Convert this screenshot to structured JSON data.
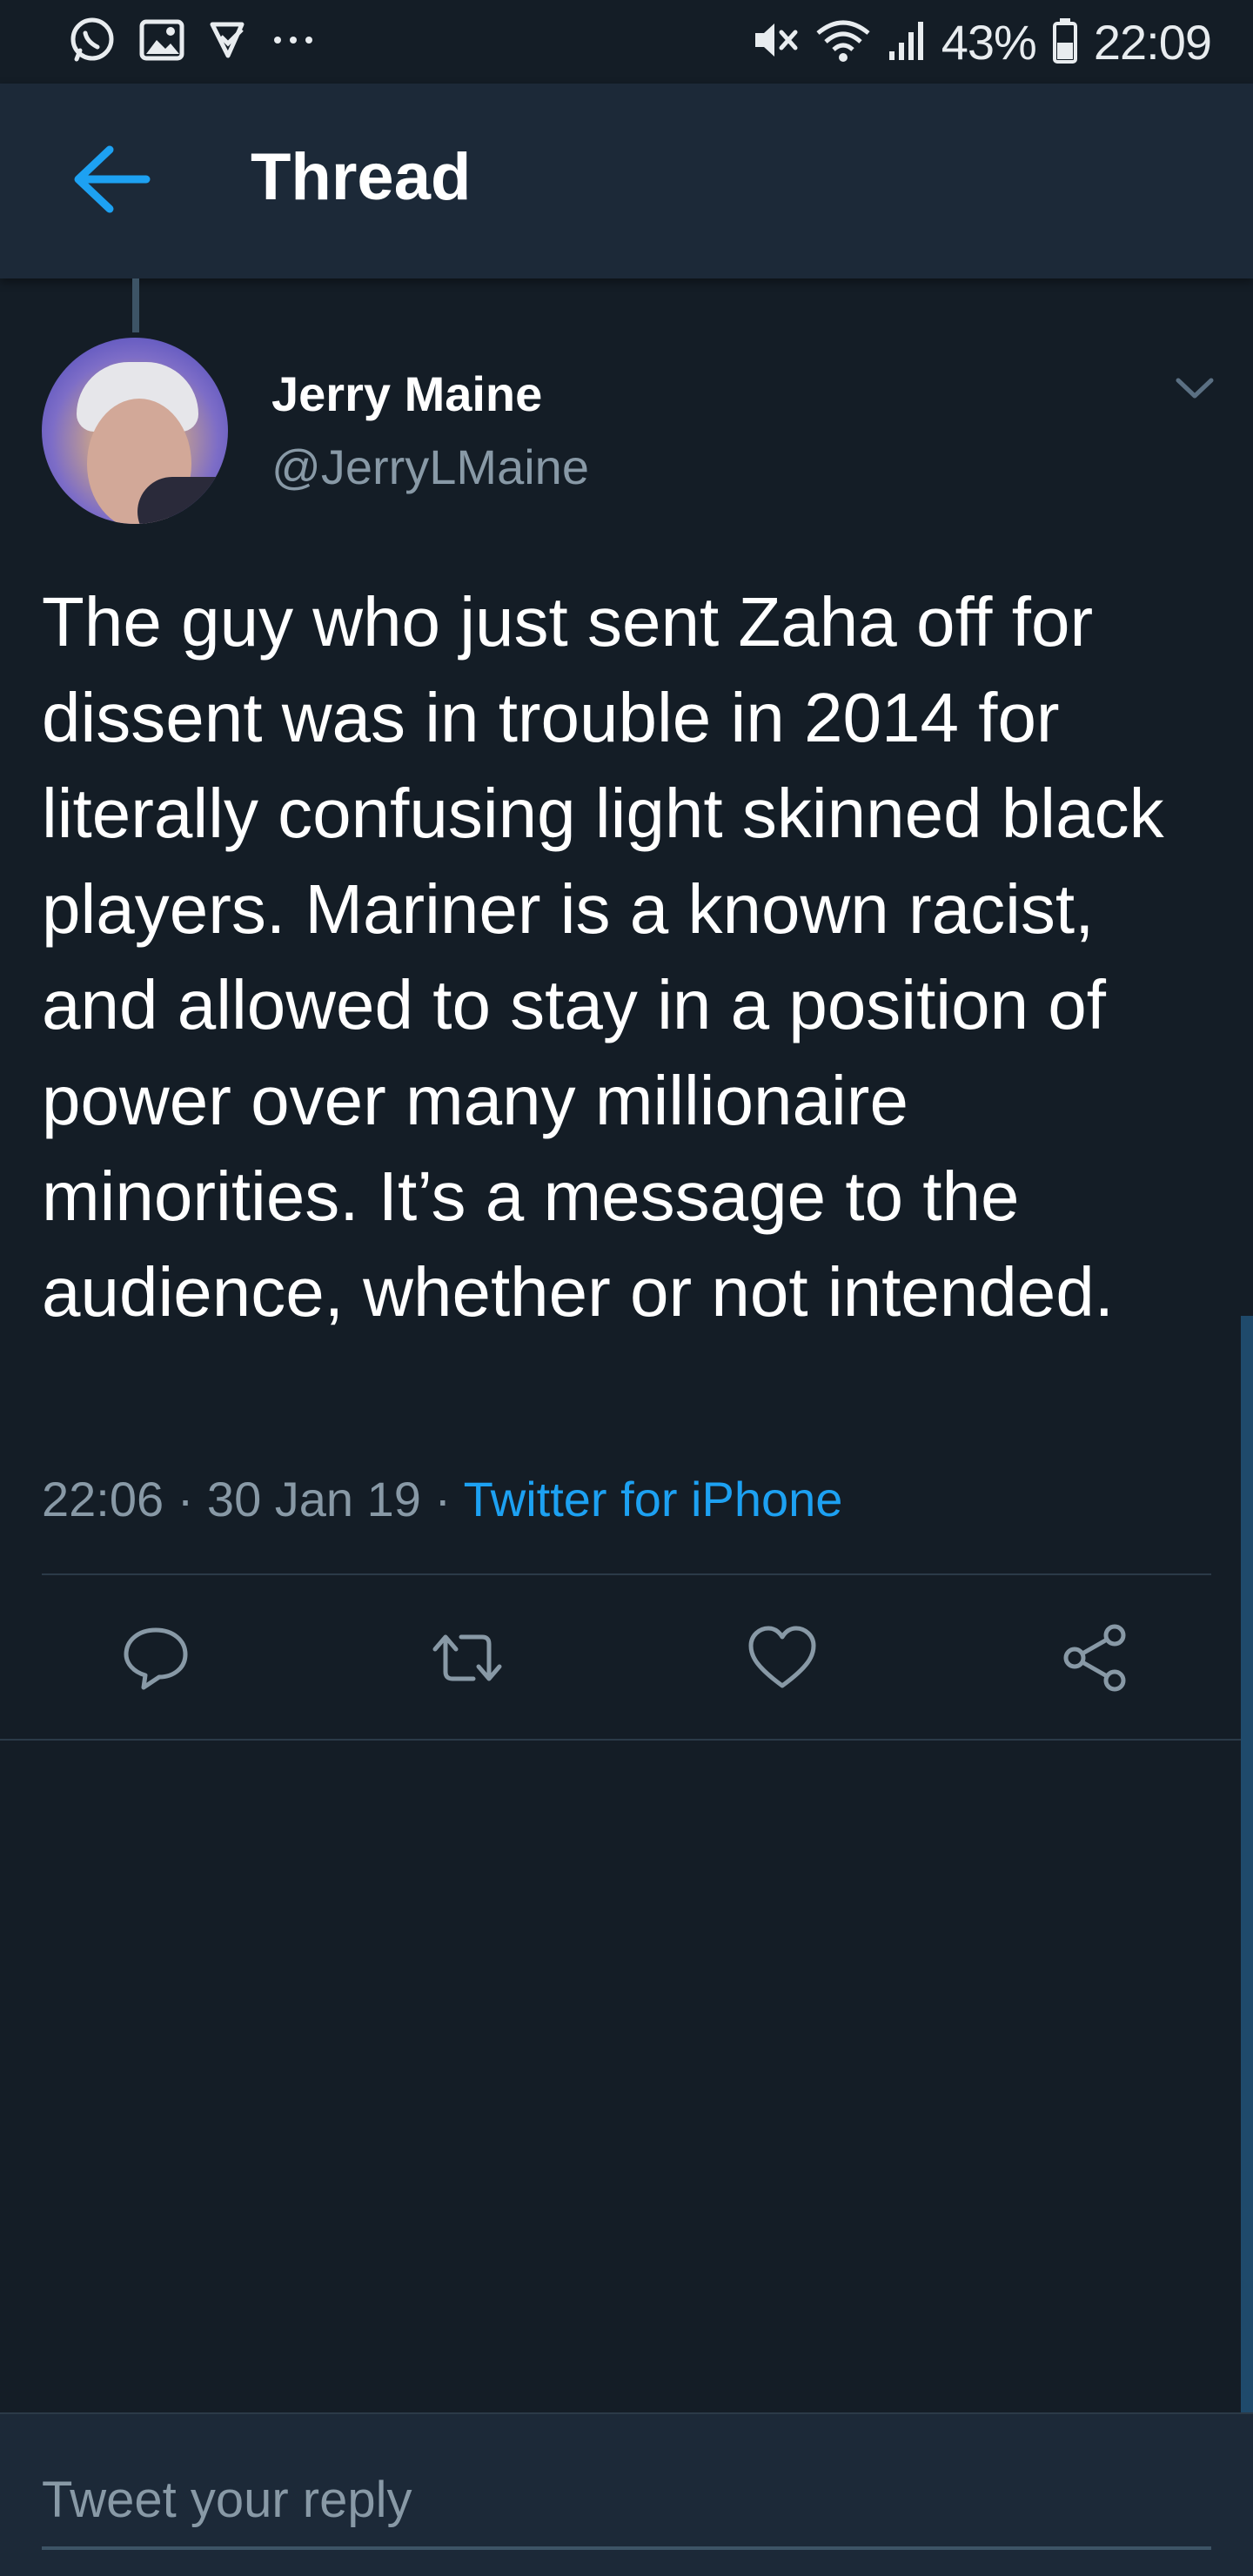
{
  "status_bar": {
    "left_icons": [
      "whatsapp-icon",
      "gallery-icon",
      "check-notification-icon",
      "more-dots-icon"
    ],
    "right_icons": [
      "mute-icon",
      "wifi-icon",
      "signal-icon",
      "battery-icon"
    ],
    "battery": "43%",
    "time": "22:09"
  },
  "header": {
    "title": "Thread",
    "back_icon": "back-arrow-icon"
  },
  "tweet": {
    "display_name": "Jerry Maine",
    "handle": "@JerryLMaine",
    "text": "The guy who just sent Zaha off for dissent was in trouble in 2014 for literally confusing light skinned black players.  Mariner is a known racist, and allowed to stay in a position of power over many millionaire minorities. It’s a message to the audience, whether or not intended.",
    "time": "22:06",
    "separator": "·",
    "date": "30 Jan 19",
    "source": "Twitter for iPhone",
    "actions": [
      "reply-icon",
      "retweet-icon",
      "like-icon",
      "share-icon"
    ]
  },
  "reply": {
    "placeholder": "Tweet your reply"
  },
  "colors": {
    "background": "#141d26",
    "header": "#1c2938",
    "accent": "#1da1f2",
    "secondary_text": "#8899a6"
  }
}
